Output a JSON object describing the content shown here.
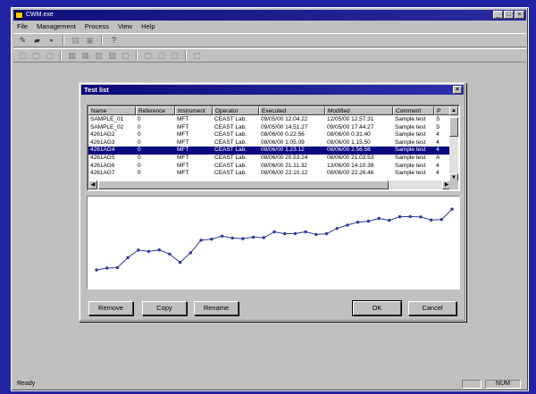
{
  "app": {
    "title": "CWM.exe",
    "menu": [
      "File",
      "Management",
      "Process",
      "View",
      "Help"
    ],
    "status": "Ready",
    "status_num": "NUM"
  },
  "dialog": {
    "title": "Test list",
    "columns": [
      "Name",
      "Reference",
      "Instrument",
      "Operator",
      "Executed",
      "Modified",
      "Comment",
      "P"
    ],
    "rows": [
      [
        "SAMPLE_01",
        "0",
        "MFT",
        "CEAST Lab.",
        "09/05/00 12.04.22",
        "12/05/00 12.57.31",
        "Sample test",
        "S"
      ],
      [
        "SAMPLE_02",
        "0",
        "MFT",
        "CEAST Lab.",
        "09/05/00 14.51.27",
        "09/05/00 17.44.27",
        "Sample test",
        "S"
      ],
      [
        "4261AG2",
        "0",
        "MFT",
        "CEAST Lab.",
        "08/06/00 0.22.56",
        "08/06/00 0.31.40",
        "Sample test",
        "4"
      ],
      [
        "4261AG3",
        "0",
        "MFT",
        "CEAST Lab.",
        "08/06/00 1.05.09",
        "08/06/00 1.15.50",
        "Sample test",
        "4"
      ],
      [
        "4261AG4",
        "0",
        "MFT",
        "CEAST Lab.",
        "08/06/00 1.23.12",
        "08/06/00 2.56.56",
        "Sample test",
        "4"
      ],
      [
        "4261AG5",
        "0",
        "MFT",
        "CEAST Lab.",
        "08/06/00 20.53.24",
        "08/06/00 21.03.53",
        "Sample test",
        "A"
      ],
      [
        "4261AG6",
        "0",
        "MFT",
        "CEAST Lab.",
        "08/06/00 21.11.32",
        "13/06/00 14.10.38",
        "Sample test",
        "4"
      ],
      [
        "4261AG7",
        "0",
        "MFT",
        "CEAST Lab.",
        "08/06/00 22.10.12",
        "08/06/00 22.26.46",
        "Sample test",
        "4"
      ]
    ],
    "selected_row": 4,
    "buttons": {
      "remove": "Remove",
      "copy": "Copy",
      "rename": "Rename",
      "ok": "OK",
      "cancel": "Cancel"
    }
  },
  "chart_data": {
    "type": "line",
    "x": [
      1,
      2,
      3,
      4,
      5,
      6,
      7,
      8,
      9,
      10,
      11,
      12,
      13,
      14,
      15,
      16,
      17,
      18,
      19,
      20,
      21,
      22,
      23,
      24,
      25,
      26,
      27,
      28,
      29,
      30,
      31,
      32,
      33,
      34
    ],
    "values": [
      8,
      9,
      9.2,
      14.5,
      18.5,
      17.8,
      18.6,
      16.4,
      12,
      17.1,
      23.8,
      24.3,
      25.9,
      24.9,
      24.6,
      25.4,
      25.1,
      28.2,
      27.2,
      27.3,
      28.2,
      26.8,
      27.2,
      30,
      31.8,
      33.3,
      33.8,
      35.3,
      34.3,
      36.2,
      36.3,
      36.1,
      34.5,
      34.7,
      40.2
    ],
    "color": "#2a3a9a",
    "ylim": [
      0,
      45
    ],
    "grid": false
  }
}
